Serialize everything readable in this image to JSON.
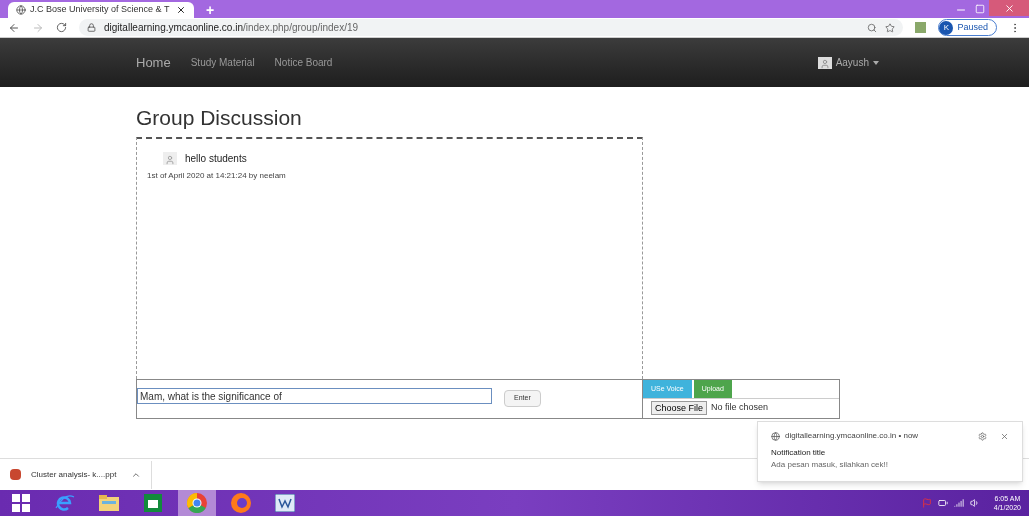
{
  "browser": {
    "tab": {
      "title": "J.C Bose University of Science & T",
      "selected": true
    },
    "new_tab": "+",
    "url_host": "digitallearning.ymcaonline.co.in",
    "url_path": "/index.php/group/index/19",
    "profile": {
      "initial": "K",
      "status": "Paused"
    }
  },
  "navbar": {
    "links": [
      {
        "label": "Home",
        "selected": true
      },
      {
        "label": "Study Material",
        "selected": false
      },
      {
        "label": "Notice Board",
        "selected": false
      }
    ],
    "user": "Aayush"
  },
  "page": {
    "title": "Group Discussion",
    "messages": [
      {
        "text": "hello students",
        "meta": "1st of April 2020 at 14:21:24 by neelam"
      }
    ],
    "message_input": {
      "value": "Mam, what is the significance of"
    },
    "enter_button": "Enter",
    "voice_button": "USe Voice",
    "upload_button": "Upload",
    "file_button": "Choose File",
    "file_status": "No file chosen"
  },
  "notification": {
    "source": "digitallearning.ymcaonline.co.in",
    "time": "• now",
    "title": "Notification title",
    "body": "Ada pesan masuk, silahkan cek!!"
  },
  "download_bar": {
    "file": "Cluster analysis- k....ppt"
  },
  "taskbar": {
    "apps": [
      {
        "kind": "start",
        "selected": false
      },
      {
        "kind": "ie",
        "selected": false
      },
      {
        "kind": "explorer",
        "selected": false
      },
      {
        "kind": "store",
        "selected": false
      },
      {
        "kind": "chrome",
        "selected": true
      },
      {
        "kind": "firefox",
        "selected": false
      },
      {
        "kind": "word",
        "selected": false
      }
    ],
    "time": "6:05 AM",
    "date": "4/1/2020"
  }
}
